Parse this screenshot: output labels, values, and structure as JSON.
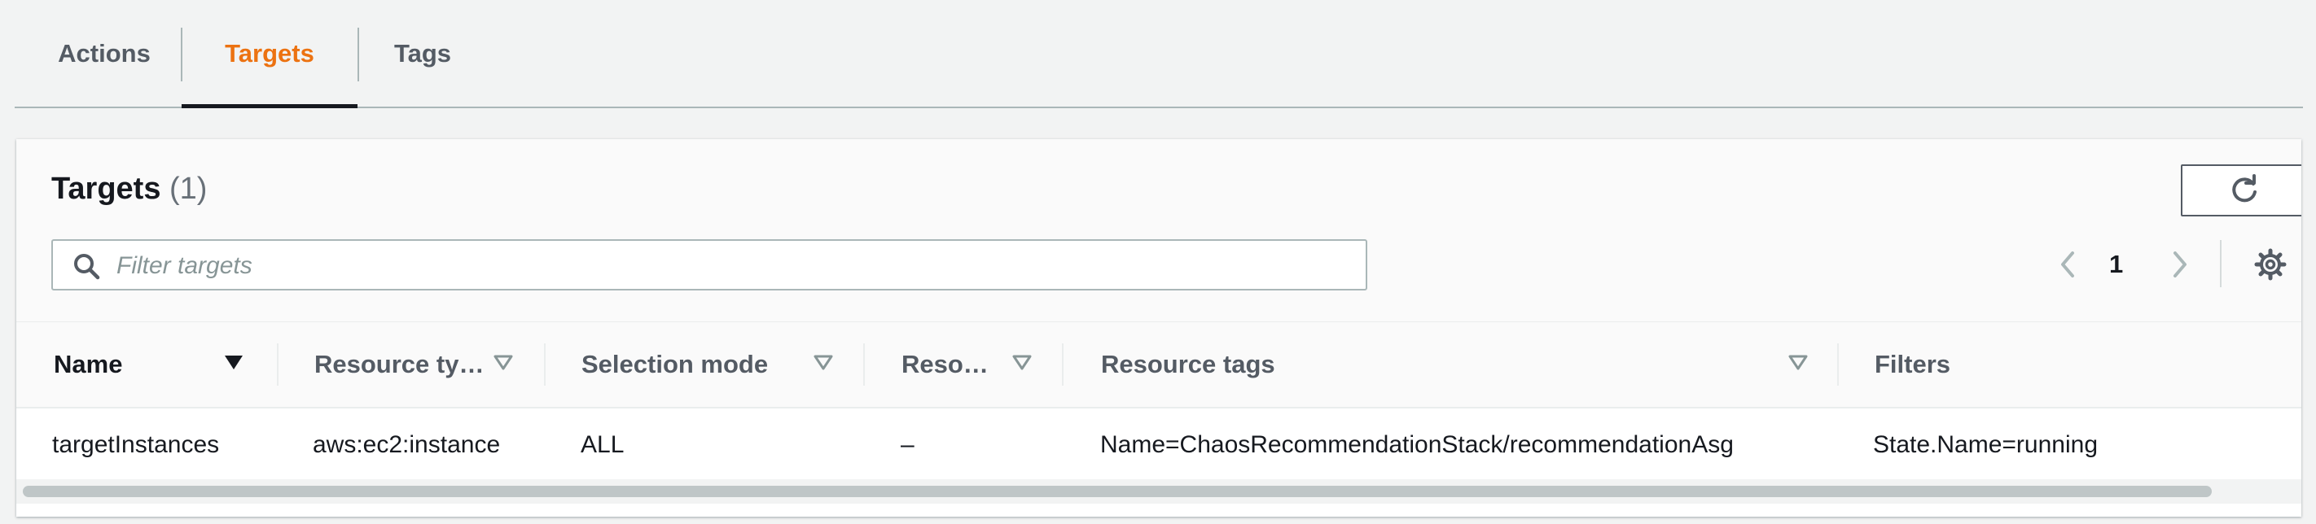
{
  "tabs": [
    {
      "label": "Actions"
    },
    {
      "label": "Targets",
      "active": true
    },
    {
      "label": "Tags"
    }
  ],
  "colors": {
    "active_tab": "#ec7211",
    "text": "#16191f",
    "muted": "#545b64"
  },
  "panel": {
    "title": "Targets",
    "count": "(1)",
    "search": {
      "placeholder": "Filter targets",
      "value": ""
    },
    "pagination": {
      "current_page": "1"
    },
    "icons": {
      "refresh": "refresh-icon",
      "search": "search-icon",
      "prev": "chevron-left-icon",
      "next": "chevron-right-icon",
      "settings": "gear-icon"
    }
  },
  "table": {
    "columns": [
      {
        "label": "Name",
        "sorted": "descending"
      },
      {
        "label": "Resource ty…"
      },
      {
        "label": "Selection mode"
      },
      {
        "label": "Reso…"
      },
      {
        "label": "Resource tags"
      },
      {
        "label": "Filters"
      }
    ],
    "rows": [
      {
        "name": "targetInstances",
        "resource_type": "aws:ec2:instance",
        "selection_mode": "ALL",
        "resource": "–",
        "resource_tags": "Name=ChaosRecommendationStack/recommendationAsg",
        "filters": "State.Name=running"
      }
    ]
  }
}
